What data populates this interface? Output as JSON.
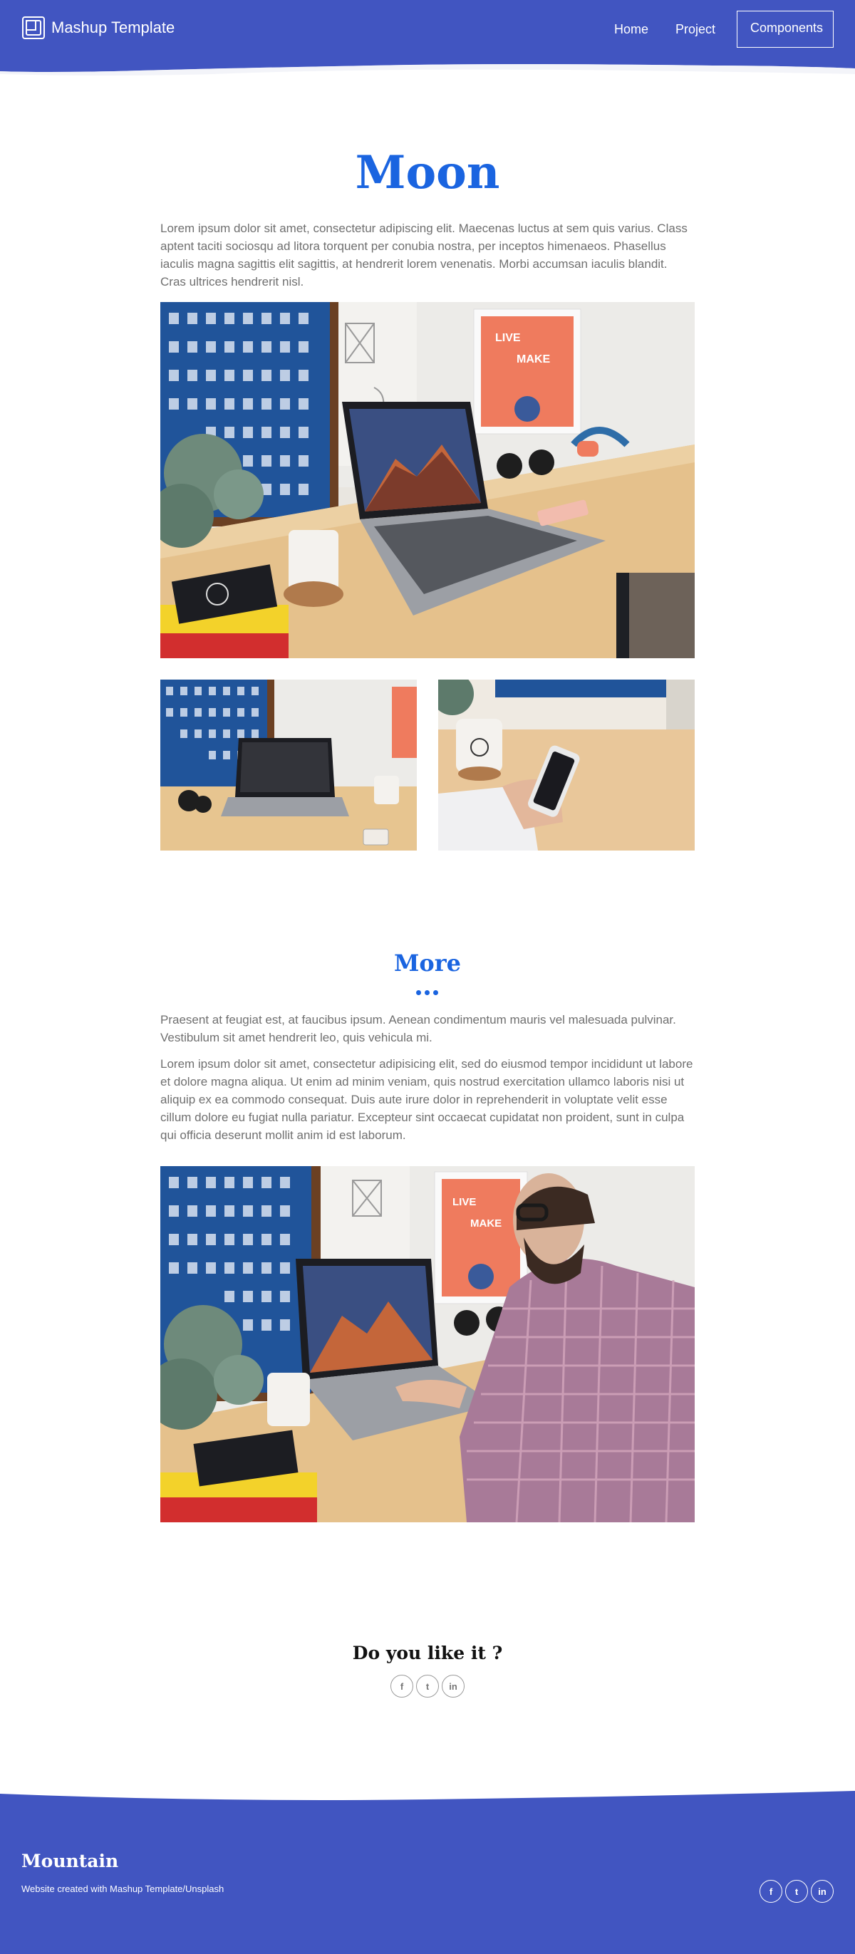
{
  "navbar": {
    "brand": "Mashup Template",
    "links": [
      "Home",
      "Project"
    ],
    "cta": "Components",
    "color": "#4155c1"
  },
  "article": {
    "title": "Moon",
    "intro": "Lorem ipsum dolor sit amet, consectetur adipiscing elit. Maecenas luctus at sem quis varius. Class aptent taciti sociosqu ad litora torquent per conubia nostra, per inceptos himenaeos. Phasellus iaculis magna sagittis elit sagittis, at hendrerit lorem venenatis. Morbi accumsan iaculis blandit. Cras ultrices hendrerit nisl.",
    "section_title": "More",
    "section_text_1": "Praesent at feugiat est, at faucibus ipsum. Aenean condimentum mauris vel malesuada pulvinar. Vestibulum sit amet hendrerit leo, quis vehicula mi.",
    "section_text_2": "Lorem ipsum dolor sit amet, consectetur adipisicing elit, sed do eiusmod tempor incididunt ut labore et dolore magna aliqua. Ut enim ad minim veniam, quis nostrud exercitation ullamco laboris nisi ut aliquip ex ea commodo consequat. Duis aute irure dolor in reprehenderit in voluptate velit esse cillum dolore eu fugiat nulla pariatur. Excepteur sint occaecat cupidatat non proident, sunt in culpa qui officia deserunt mollit anim id est laborum.",
    "accent": "#1a64e0"
  },
  "share": {
    "title": "Do you like it ?",
    "icons": [
      "facebook-icon",
      "twitter-icon",
      "linkedin-icon"
    ],
    "glyphs": [
      "f",
      "t",
      "in"
    ]
  },
  "footer": {
    "title": "Mountain",
    "credit": "Website created with Mashup Template/Unsplash"
  }
}
